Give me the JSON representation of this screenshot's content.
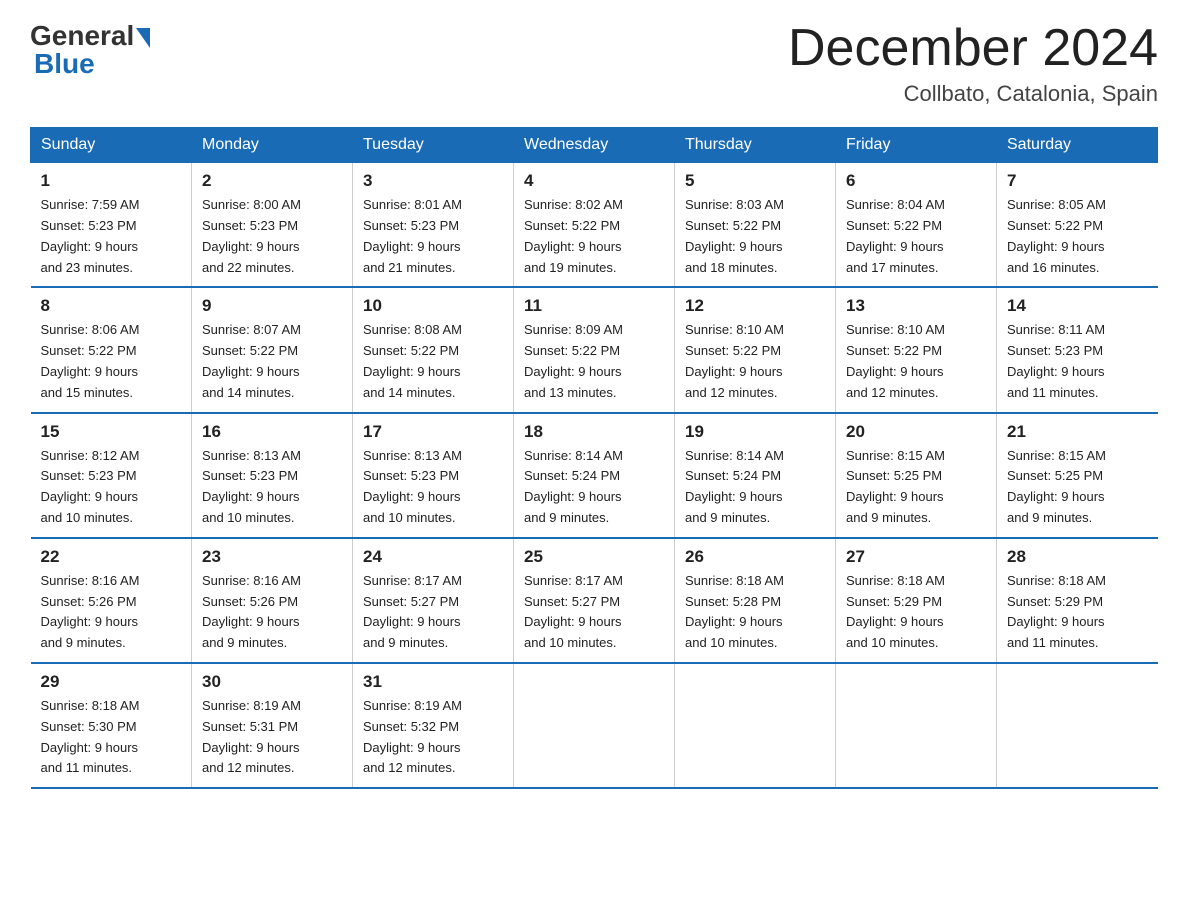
{
  "header": {
    "logo_general": "General",
    "logo_blue": "Blue",
    "month_title": "December 2024",
    "location": "Collbato, Catalonia, Spain"
  },
  "weekdays": [
    "Sunday",
    "Monday",
    "Tuesday",
    "Wednesday",
    "Thursday",
    "Friday",
    "Saturday"
  ],
  "weeks": [
    [
      {
        "day": "1",
        "sunrise": "7:59 AM",
        "sunset": "5:23 PM",
        "daylight": "9 hours and 23 minutes."
      },
      {
        "day": "2",
        "sunrise": "8:00 AM",
        "sunset": "5:23 PM",
        "daylight": "9 hours and 22 minutes."
      },
      {
        "day": "3",
        "sunrise": "8:01 AM",
        "sunset": "5:23 PM",
        "daylight": "9 hours and 21 minutes."
      },
      {
        "day": "4",
        "sunrise": "8:02 AM",
        "sunset": "5:22 PM",
        "daylight": "9 hours and 19 minutes."
      },
      {
        "day": "5",
        "sunrise": "8:03 AM",
        "sunset": "5:22 PM",
        "daylight": "9 hours and 18 minutes."
      },
      {
        "day": "6",
        "sunrise": "8:04 AM",
        "sunset": "5:22 PM",
        "daylight": "9 hours and 17 minutes."
      },
      {
        "day": "7",
        "sunrise": "8:05 AM",
        "sunset": "5:22 PM",
        "daylight": "9 hours and 16 minutes."
      }
    ],
    [
      {
        "day": "8",
        "sunrise": "8:06 AM",
        "sunset": "5:22 PM",
        "daylight": "9 hours and 15 minutes."
      },
      {
        "day": "9",
        "sunrise": "8:07 AM",
        "sunset": "5:22 PM",
        "daylight": "9 hours and 14 minutes."
      },
      {
        "day": "10",
        "sunrise": "8:08 AM",
        "sunset": "5:22 PM",
        "daylight": "9 hours and 14 minutes."
      },
      {
        "day": "11",
        "sunrise": "8:09 AM",
        "sunset": "5:22 PM",
        "daylight": "9 hours and 13 minutes."
      },
      {
        "day": "12",
        "sunrise": "8:10 AM",
        "sunset": "5:22 PM",
        "daylight": "9 hours and 12 minutes."
      },
      {
        "day": "13",
        "sunrise": "8:10 AM",
        "sunset": "5:22 PM",
        "daylight": "9 hours and 12 minutes."
      },
      {
        "day": "14",
        "sunrise": "8:11 AM",
        "sunset": "5:23 PM",
        "daylight": "9 hours and 11 minutes."
      }
    ],
    [
      {
        "day": "15",
        "sunrise": "8:12 AM",
        "sunset": "5:23 PM",
        "daylight": "9 hours and 10 minutes."
      },
      {
        "day": "16",
        "sunrise": "8:13 AM",
        "sunset": "5:23 PM",
        "daylight": "9 hours and 10 minutes."
      },
      {
        "day": "17",
        "sunrise": "8:13 AM",
        "sunset": "5:23 PM",
        "daylight": "9 hours and 10 minutes."
      },
      {
        "day": "18",
        "sunrise": "8:14 AM",
        "sunset": "5:24 PM",
        "daylight": "9 hours and 9 minutes."
      },
      {
        "day": "19",
        "sunrise": "8:14 AM",
        "sunset": "5:24 PM",
        "daylight": "9 hours and 9 minutes."
      },
      {
        "day": "20",
        "sunrise": "8:15 AM",
        "sunset": "5:25 PM",
        "daylight": "9 hours and 9 minutes."
      },
      {
        "day": "21",
        "sunrise": "8:15 AM",
        "sunset": "5:25 PM",
        "daylight": "9 hours and 9 minutes."
      }
    ],
    [
      {
        "day": "22",
        "sunrise": "8:16 AM",
        "sunset": "5:26 PM",
        "daylight": "9 hours and 9 minutes."
      },
      {
        "day": "23",
        "sunrise": "8:16 AM",
        "sunset": "5:26 PM",
        "daylight": "9 hours and 9 minutes."
      },
      {
        "day": "24",
        "sunrise": "8:17 AM",
        "sunset": "5:27 PM",
        "daylight": "9 hours and 9 minutes."
      },
      {
        "day": "25",
        "sunrise": "8:17 AM",
        "sunset": "5:27 PM",
        "daylight": "9 hours and 10 minutes."
      },
      {
        "day": "26",
        "sunrise": "8:18 AM",
        "sunset": "5:28 PM",
        "daylight": "9 hours and 10 minutes."
      },
      {
        "day": "27",
        "sunrise": "8:18 AM",
        "sunset": "5:29 PM",
        "daylight": "9 hours and 10 minutes."
      },
      {
        "day": "28",
        "sunrise": "8:18 AM",
        "sunset": "5:29 PM",
        "daylight": "9 hours and 11 minutes."
      }
    ],
    [
      {
        "day": "29",
        "sunrise": "8:18 AM",
        "sunset": "5:30 PM",
        "daylight": "9 hours and 11 minutes."
      },
      {
        "day": "30",
        "sunrise": "8:19 AM",
        "sunset": "5:31 PM",
        "daylight": "9 hours and 12 minutes."
      },
      {
        "day": "31",
        "sunrise": "8:19 AM",
        "sunset": "5:32 PM",
        "daylight": "9 hours and 12 minutes."
      },
      null,
      null,
      null,
      null
    ]
  ],
  "labels": {
    "sunrise": "Sunrise:",
    "sunset": "Sunset:",
    "daylight": "Daylight:"
  }
}
